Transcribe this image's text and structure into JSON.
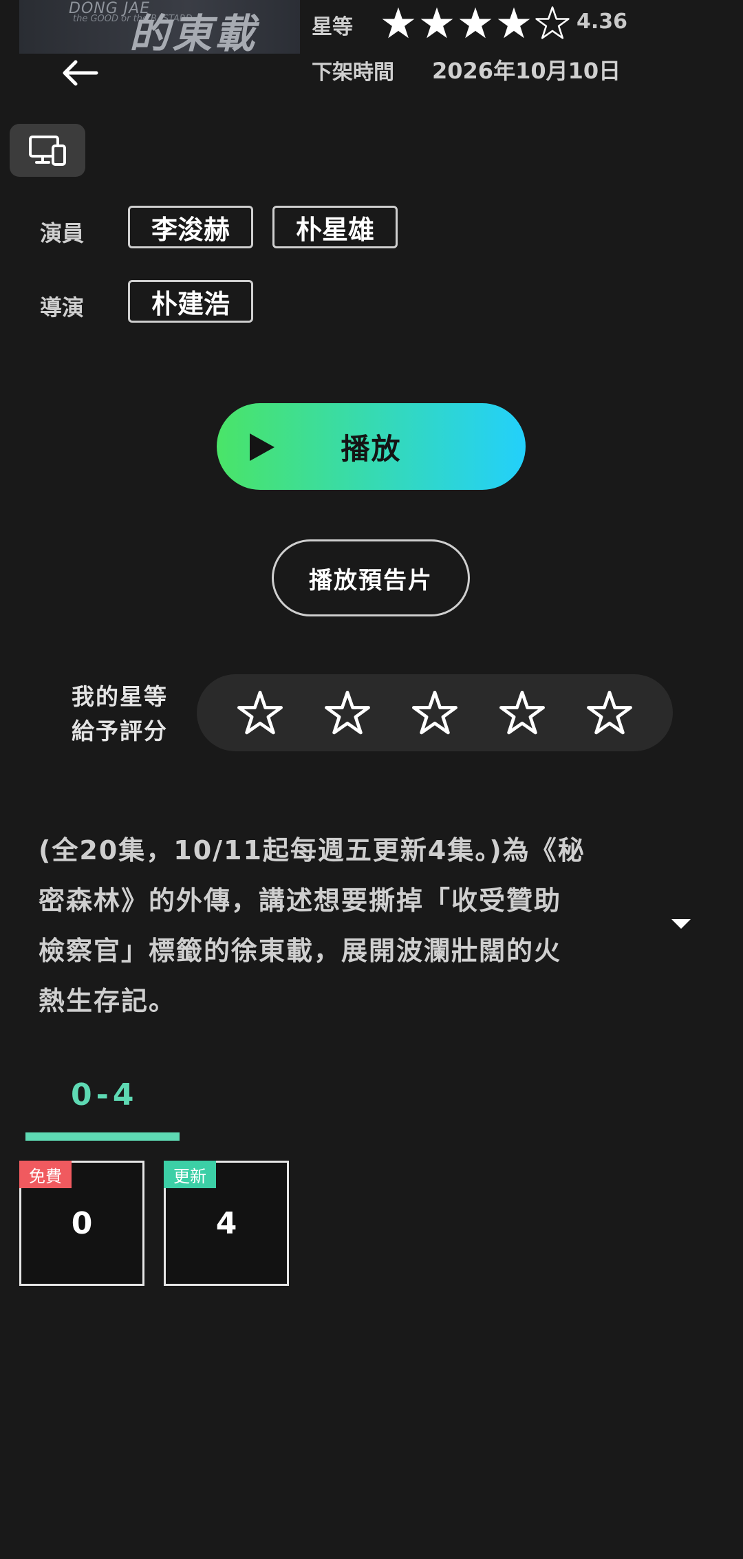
{
  "poster": {
    "title_en_1": "DONG JAE",
    "title_en_2": "the GOOD or the BASTARD",
    "title_zh": "的東載"
  },
  "header": {
    "rating_label": "星等",
    "rating_value": "4.36",
    "rating_stars": 4.36,
    "expiry_label": "下架時間",
    "expiry_value": "2026年10月10日"
  },
  "cast": {
    "label": "演員",
    "names": [
      "李浚赫",
      "朴星雄"
    ]
  },
  "director": {
    "label": "導演",
    "names": [
      "朴建浩"
    ]
  },
  "actions": {
    "play_label": "播放",
    "trailer_label": "播放預告片"
  },
  "my_rating": {
    "label_line1": "我的星等",
    "label_line2": "給予評分",
    "max_stars": 5
  },
  "description": {
    "lines": [
      "(全20集，10/11起每週五更新4集。)為《秘",
      "密森林》的外傳，講述想要撕掉「收受贊助",
      "檢察官」標籤的徐東載，展開波瀾壯闊的火",
      "熱生存記。"
    ]
  },
  "episodes": {
    "tab_label": "0-4",
    "items": [
      {
        "number": "0",
        "badge": "免費",
        "badge_color": "#f05a5f"
      },
      {
        "number": "4",
        "badge": "更新",
        "badge_color": "#3ccfa6"
      }
    ]
  },
  "colors": {
    "accent": "#5ed9b3",
    "play_gradient_start": "#4ae468",
    "play_gradient_end": "#23d0fb"
  }
}
